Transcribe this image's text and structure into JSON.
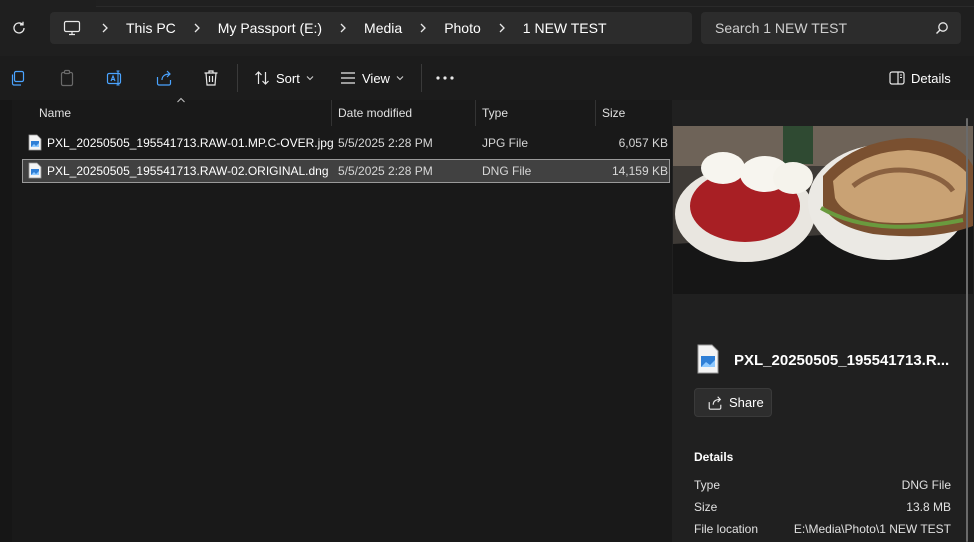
{
  "breadcrumb": [
    "This PC",
    "My Passport (E:)",
    "Media",
    "Photo",
    "1 NEW TEST"
  ],
  "search": {
    "placeholder": "Search 1 NEW TEST"
  },
  "toolbar": {
    "sort_label": "Sort",
    "view_label": "View",
    "details_label": "Details"
  },
  "columns": {
    "name": "Name",
    "date": "Date modified",
    "type": "Type",
    "size": "Size"
  },
  "files": [
    {
      "name": "PXL_20250505_195541713.RAW-01.MP.C-OVER.jpg",
      "date": "5/5/2025 2:28 PM",
      "type": "JPG File",
      "size": "6,057 KB"
    },
    {
      "name": "PXL_20250505_195541713.RAW-02.ORIGINAL.dng",
      "date": "5/5/2025 2:28 PM",
      "type": "DNG File",
      "size": "14,159 KB"
    }
  ],
  "details_pane": {
    "file_name": "PXL_20250505_195541713.R...",
    "share_label": "Share",
    "section_title": "Details",
    "props": [
      {
        "key": "Type",
        "value": "DNG File"
      },
      {
        "key": "Size",
        "value": "13.8 MB"
      },
      {
        "key": "File location",
        "value": "E:\\Media\\Photo\\1 NEW TEST"
      }
    ]
  },
  "icons": {
    "refresh": "refresh-icon",
    "pc": "computer-icon",
    "chevron": "chevron-right-icon",
    "search": "search-icon",
    "new_window": "copy-icon",
    "paste": "paste-icon",
    "rename": "rename-icon",
    "share": "share-icon",
    "delete": "trash-icon",
    "sort": "sort-icon",
    "view": "view-list-icon",
    "more": "more-icon",
    "details": "details-pane-icon"
  },
  "colors": {
    "accent": "#4aa3ff",
    "background": "#191919",
    "selection": "#414141"
  }
}
